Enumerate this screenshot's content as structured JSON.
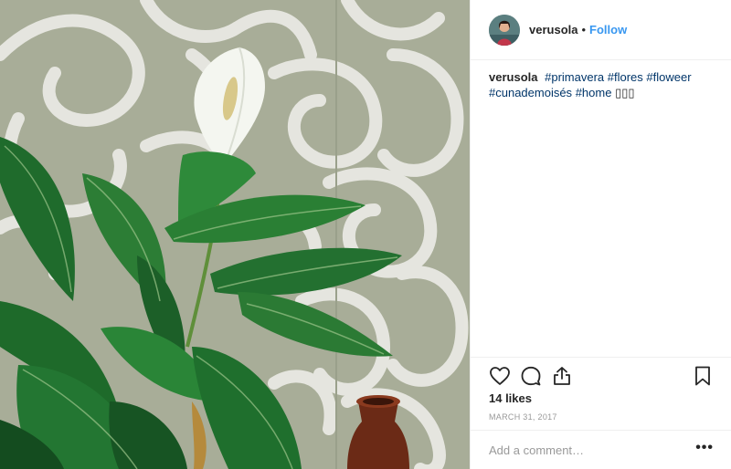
{
  "post": {
    "image_alt_subject": "peace-lily-photo"
  },
  "header": {
    "username": "verusola",
    "separator": "•",
    "follow_label": "Follow"
  },
  "caption": {
    "username": "verusola",
    "tags": [
      "#primavera",
      "#flores",
      "#floweer",
      "#cunademoisés",
      "#home"
    ],
    "trailing": "▯▯▯"
  },
  "likes": {
    "text": "14 likes"
  },
  "date": {
    "text": "MARCH 31, 2017"
  },
  "comment": {
    "placeholder": "Add a comment…",
    "more_label": "•••"
  },
  "colors": {
    "accent": "#3897f0",
    "hashtag": "#003569",
    "wall": "#a8ad98",
    "leaf": "#1f6b2c"
  },
  "icons": {
    "like": "heart-icon",
    "comment": "comment-icon",
    "share": "share-icon",
    "save": "bookmark-icon",
    "more": "more-icon"
  }
}
